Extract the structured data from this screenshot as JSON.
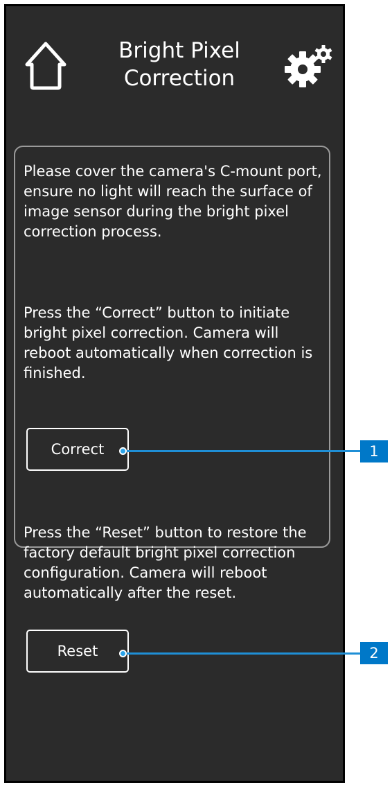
{
  "header": {
    "title": "Bright Pixel\nCorrection",
    "home_icon": "home-icon",
    "settings_icon": "gear-icon"
  },
  "panel": {
    "paragraph1": "Please cover the camera's C-mount port, ensure no light will reach the surface of image sensor during the bright pixel correction process.",
    "paragraph2": "Press the “Correct” button to initiate bright pixel correction. Camera will reboot automatically when correction is finished.",
    "correct_label": "Correct",
    "paragraph3": "Press the “Reset” button to restore the factory default bright pixel correction configuration. Camera will reboot automatically after the reset.",
    "reset_label": "Reset"
  },
  "callouts": {
    "one": "1",
    "two": "2"
  },
  "colors": {
    "background": "#2b2b2b",
    "text": "#ffffff",
    "panel_border": "#9a9a9a",
    "callout": "#0078c8"
  }
}
